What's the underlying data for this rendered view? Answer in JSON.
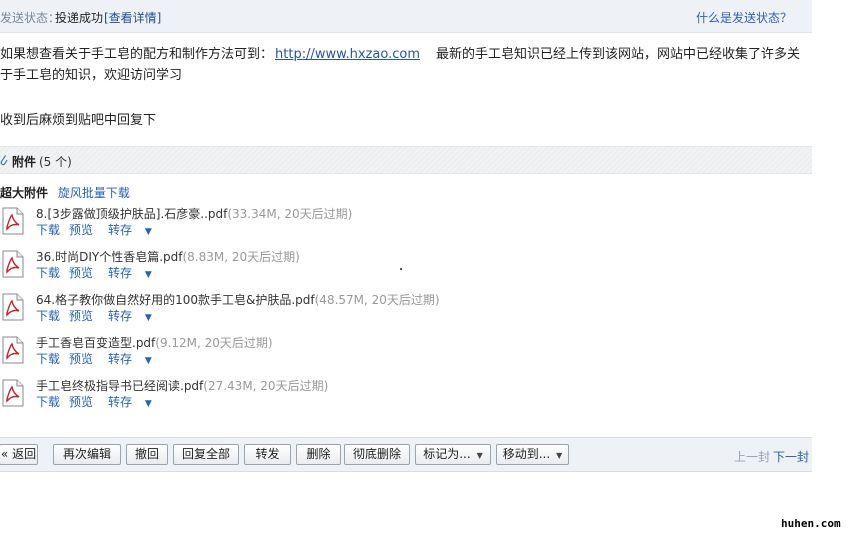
{
  "status": {
    "label": "发送状态：",
    "value": "投递成功",
    "details_link": "[查看详情]",
    "help_link": "什么是发送状态？"
  },
  "message": {
    "line1_prefix": "如果想查看关于手工皂的配方和制作方法可到：",
    "url": "http://www.hxzao.com",
    "line1_suffix": "最新的手工皂知识已经上传到该网站，网站中已经收集了许多关于手工皂的知识，欢迎访问学习",
    "line2": "收到后麻烦到贴吧中回复下"
  },
  "attachments": {
    "title": "附件",
    "count": "(5 个)",
    "super_label": "超大附件",
    "batch_download": "旋风批量下载",
    "items": [
      {
        "name": "8.[3步露做顶级护肤品].石彦豪..pdf",
        "meta": "(33.34M, 20天后过期)"
      },
      {
        "name": "36.时尚DIY个性香皂篇.pdf",
        "meta": "(8.83M, 20天后过期)"
      },
      {
        "name": "64.格子教你做自然好用的100款手工皂&护肤品.pdf",
        "meta": "(48.57M, 20天后过期)"
      },
      {
        "name": "手工香皂百变造型.pdf",
        "meta": "(9.12M, 20天后过期)"
      },
      {
        "name": "手工皂终极指导书已经阅读.pdf",
        "meta": "(27.43M, 20天后过期)"
      }
    ],
    "actions": {
      "download": "下载",
      "preview": "预览",
      "save": "转存"
    }
  },
  "toolbar": {
    "back": "« 返回",
    "reedit": "再次编辑",
    "recall": "撤回",
    "reply_all": "回复全部",
    "forward": "转发",
    "delete": "删除",
    "delete_perm": "彻底删除",
    "mark_as": "标记为...",
    "move_to": "移动到...",
    "prev": "上一封",
    "next": "下一封"
  },
  "watermark": "huhen.com"
}
